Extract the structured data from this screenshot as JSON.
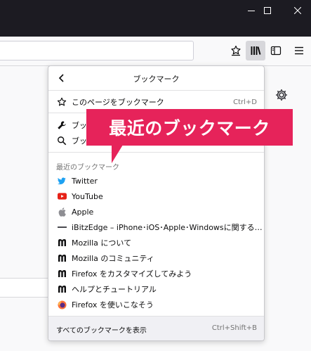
{
  "window": {
    "controls": {
      "minimize": "minimize-icon",
      "maximize": "maximize-icon",
      "close": "close-icon"
    }
  },
  "toolbar": {
    "icons": [
      "reading-list-icon",
      "library-icon",
      "sidebar-icon",
      "menu-icon"
    ]
  },
  "panel": {
    "title": "ブックマーク",
    "items_top": [
      {
        "label": "このページをブックマーク",
        "shortcut": "Ctrl+D",
        "icon": "star-icon"
      },
      {
        "label": "ブック",
        "shortcut": "",
        "icon": "wrench-icon"
      },
      {
        "label": "ブック",
        "shortcut": "",
        "icon": "search-icon"
      }
    ],
    "section_label": "最近のブックマーク",
    "recent": [
      {
        "label": "Twitter",
        "icon": "twitter-icon"
      },
      {
        "label": "YouTube",
        "icon": "youtube-icon"
      },
      {
        "label": "Apple",
        "icon": "apple-icon"
      },
      {
        "label": "iBitzEdge – iPhone･iOS･Apple･Windowsに関する情報サ…",
        "icon": "ibitzedge-icon"
      },
      {
        "label": "Mozilla について",
        "icon": "mozilla-icon"
      },
      {
        "label": "Mozilla のコミュニティ",
        "icon": "mozilla-icon"
      },
      {
        "label": "Firefox をカスタマイズしてみよう",
        "icon": "mozilla-icon"
      },
      {
        "label": "ヘルプとチュートリアル",
        "icon": "mozilla-icon"
      },
      {
        "label": "Firefox を使いこなそう",
        "icon": "firefox-icon"
      }
    ],
    "footer": {
      "label": "すべてのブックマークを表示",
      "shortcut": "Ctrl+Shift+B"
    }
  },
  "callout": {
    "text": "最近のブックマーク"
  },
  "colors": {
    "callout": "#e6235a",
    "titlebar": "#1c1b22",
    "twitter": "#1da1f2",
    "youtube": "#e62117"
  }
}
